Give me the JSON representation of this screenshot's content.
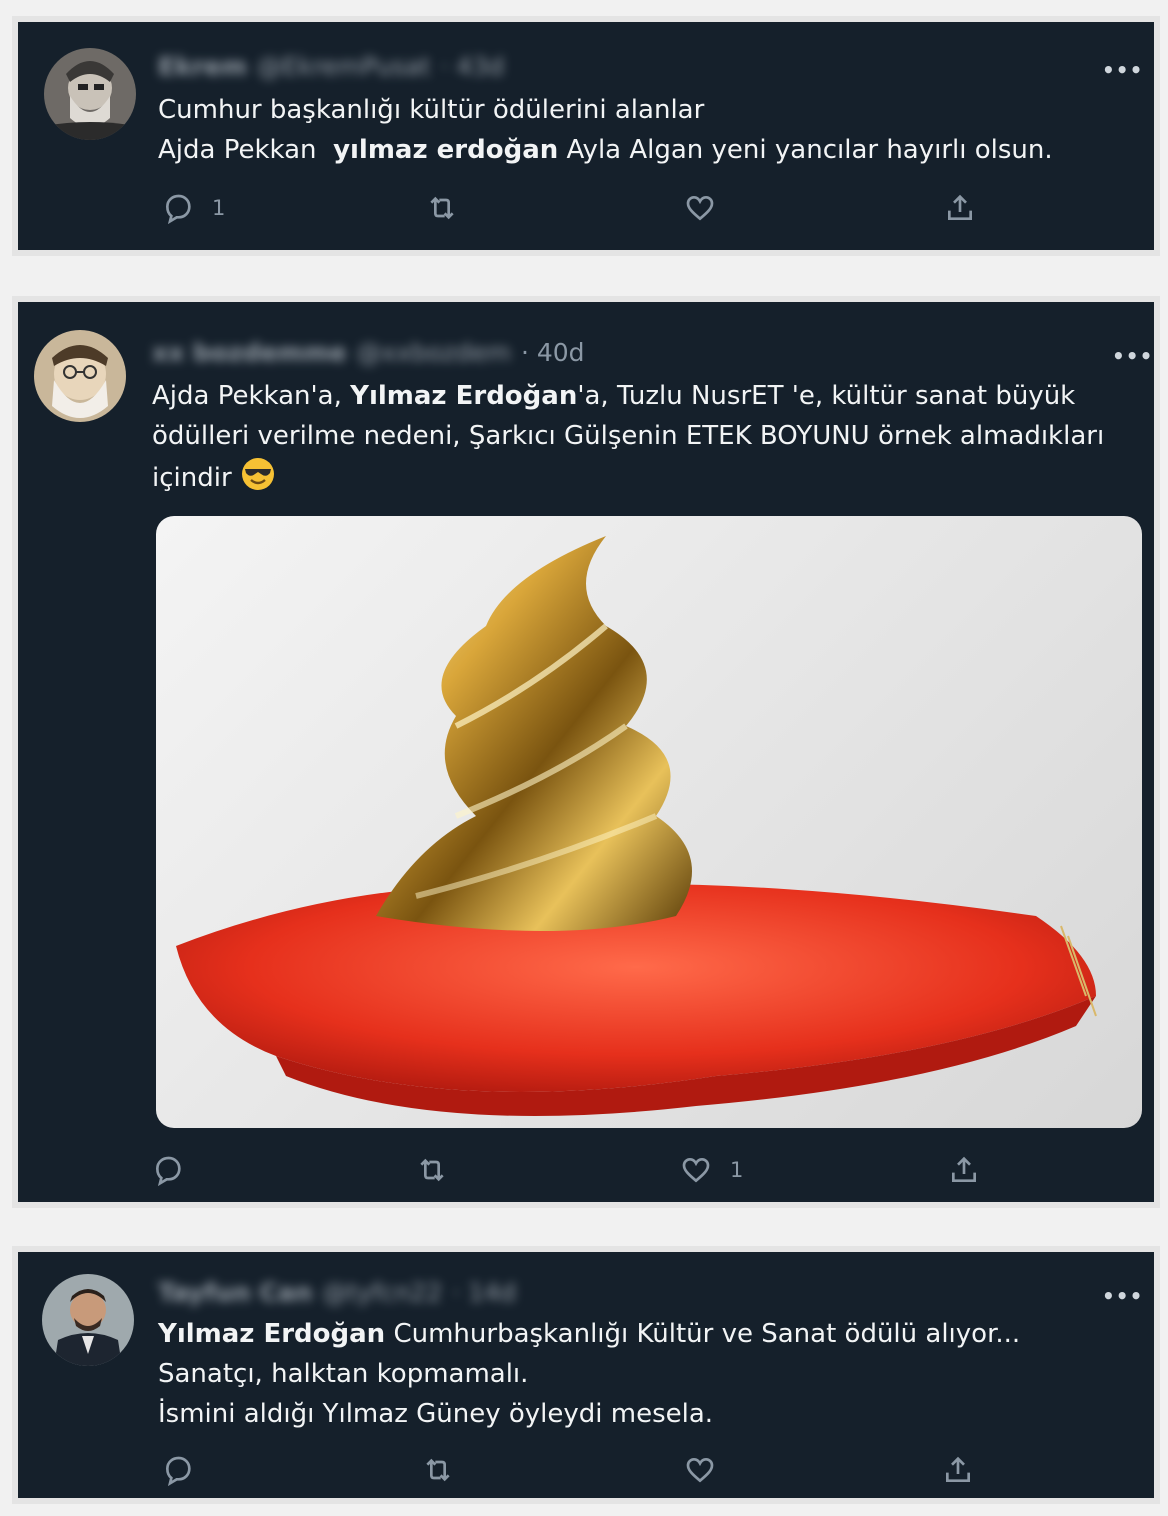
{
  "tweets": [
    {
      "author_name": "Ekrem",
      "author_handle": "@EkremPusat",
      "time": "· 43d",
      "lines": [
        {
          "plain": "Cumhur başkanlığı kültür ödülerini alanlar"
        },
        {
          "pre": "Ajda Pekkan  ",
          "bold": "yılmaz erdoğan",
          "post": " Ayla Algan yeni yancılar hayırlı olsun."
        }
      ],
      "reply_count": "1",
      "retweet_count": "",
      "like_count": "",
      "more_label": "•••"
    },
    {
      "author_name": "xx bozdemme",
      "author_handle": "@xxbozdem",
      "time": "· 40d",
      "lines": [
        {
          "pre": "Ajda Pekkan'a, ",
          "bold": "Yılmaz Erdoğan",
          "post": "'a, Tuzlu NusrET 'e, kültür sanat büyük"
        },
        {
          "plain": "ödülleri verilme nedeni, Şarkıcı Gülşenin ETEK BOYUNU örnek almadıkları"
        },
        {
          "plain": "içindir"
        }
      ],
      "reply_count": "",
      "retweet_count": "",
      "like_count": "1",
      "more_label": "•••"
    },
    {
      "author_name": "Tayfun Can",
      "author_handle": "@tyfcn22",
      "time": "· 14d",
      "lines": [
        {
          "pre": "",
          "bold": "Yılmaz Erdoğan",
          "post": " Cumhurbaşkanlığı Kültür ve Sanat ödülü alıyor..."
        },
        {
          "plain": "Sanatçı, halktan kopmamalı."
        },
        {
          "plain": "İsmini aldığı Yılmaz Güney öyleydi mesela."
        }
      ],
      "reply_count": "",
      "retweet_count": "",
      "like_count": "",
      "more_label": "•••"
    }
  ],
  "icons": {
    "reply": "reply-icon",
    "retweet": "retweet-icon",
    "like": "heart-icon",
    "share": "share-icon",
    "emoji": "smiling-face-with-sunglasses-emoji"
  },
  "colors": {
    "card_bg": "#15202b",
    "text": "#e7e9ea",
    "muted": "#8b98a5"
  }
}
